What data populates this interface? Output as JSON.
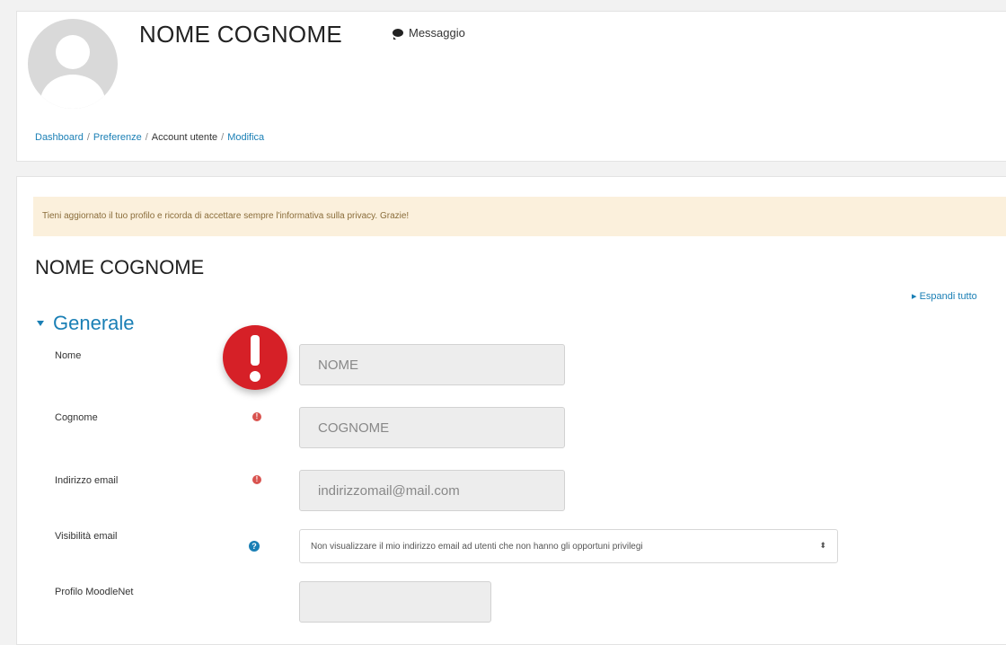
{
  "header": {
    "user_name": "NOME COGNOME",
    "message_label": "Messaggio",
    "breadcrumb": [
      "Dashboard",
      "Preferenze",
      "Account utente",
      "Modifica"
    ]
  },
  "notice": "Tieni aggiornato il tuo profilo e ricorda di accettare sempre l'informativa sulla privacy. Grazie!",
  "page_title": "NOME COGNOME",
  "expand_all": "Espandi tutto",
  "section": {
    "title": "Generale"
  },
  "fields": {
    "nome": {
      "label": "Nome",
      "value": "NOME"
    },
    "cognome": {
      "label": "Cognome",
      "value": "COGNOME"
    },
    "email": {
      "label": "Indirizzo email",
      "value": "indirizzomail@mail.com"
    },
    "visibilita": {
      "label": "Visibilità email",
      "value": "Non visualizzare il mio indirizzo email ad utenti che non hanno gli opportuni privilegi"
    },
    "moodlenet": {
      "label": "Profilo MoodleNet",
      "value": ""
    }
  },
  "colors": {
    "accent": "#1a7fb5",
    "required": "#d9534f",
    "alert_red": "#d62027",
    "notice_bg": "#fbf0dc"
  }
}
